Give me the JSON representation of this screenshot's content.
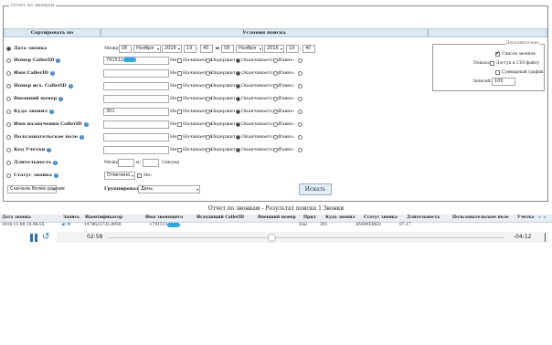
{
  "legend": "Отчет по звонкам",
  "headers": {
    "sort": "Сортировать по",
    "conditions": "Условия поиска"
  },
  "rows": [
    {
      "label": "Дата звонка",
      "checked": true,
      "help": false
    },
    {
      "label": "Номер CallerID",
      "checked": false,
      "help": true
    },
    {
      "label": "Имя CallerID",
      "checked": false,
      "help": true
    },
    {
      "label": "Номер исх. CallerID",
      "checked": false,
      "help": true
    },
    {
      "label": "Внешний номер",
      "checked": false,
      "help": true
    },
    {
      "label": "Куда звонил",
      "checked": false,
      "help": true
    },
    {
      "label": "Имя назначения CallerID",
      "checked": false,
      "help": true
    },
    {
      "label": "Пользовательское поле",
      "checked": false,
      "help": true
    },
    {
      "label": "Код Учетки",
      "checked": false,
      "help": true
    },
    {
      "label": "Длительность",
      "checked": false,
      "help": true
    },
    {
      "label": "Статус звонка",
      "checked": false,
      "help": true
    }
  ],
  "date": {
    "between": "Между:",
    "from_day": "08",
    "from_month": "Ноября",
    "from_year": "2016",
    "from_hour": "19",
    "from_min": "40",
    "and": "и",
    "to_day": "08",
    "to_month": "Ноября",
    "to_year": "2016",
    "to_hour": "19",
    "to_min": "40"
  },
  "field_values": [
    "791511",
    "",
    "",
    "",
    "301",
    "",
    "",
    ""
  ],
  "opts": {
    "not": "Не:",
    "begins": "Начинается с:",
    "contains": "Содержит:",
    "ends": "Оканчивается с:",
    "equals": "Равно:"
  },
  "duration": {
    "between": "Между:",
    "and": "и:",
    "unit": "Секунд"
  },
  "status": {
    "value": "Отвечено",
    "not": "Не:"
  },
  "order": {
    "value": "Сначала более ранние",
    "group_label": "Группировать по:",
    "group_value": "День"
  },
  "search_button": "Искать",
  "extra": {
    "legend": "Дополнительно",
    "show_label": "Показать:",
    "calls_list": "Список звонков",
    "csv_export": "Доступ к CSV-файлу",
    "summary_chart": "Суммарный график",
    "records_label": "Записей:",
    "records_value": "100"
  },
  "result_title": "Отчет по звонкам - Результат поиска 1 Звонки",
  "columns": [
    "Дата звонка",
    "Запись",
    "Идентификатор",
    "Имя звонящего",
    "Исходящий CallerID",
    "Внешний номер",
    "Прил",
    "Куда звонил",
    "Статус звонка",
    "Длительность",
    "Пользовательское поле",
    "Учетка"
  ],
  "result_row": {
    "date": "2016-11-08 19:48:55",
    "id": "1478623735.9958",
    "caller": "<791511",
    "app": "Dial",
    "dst": "301",
    "status": "ANSWERED",
    "duration": "07:17"
  },
  "player": {
    "current": "02:58",
    "remaining": "-04:12"
  }
}
